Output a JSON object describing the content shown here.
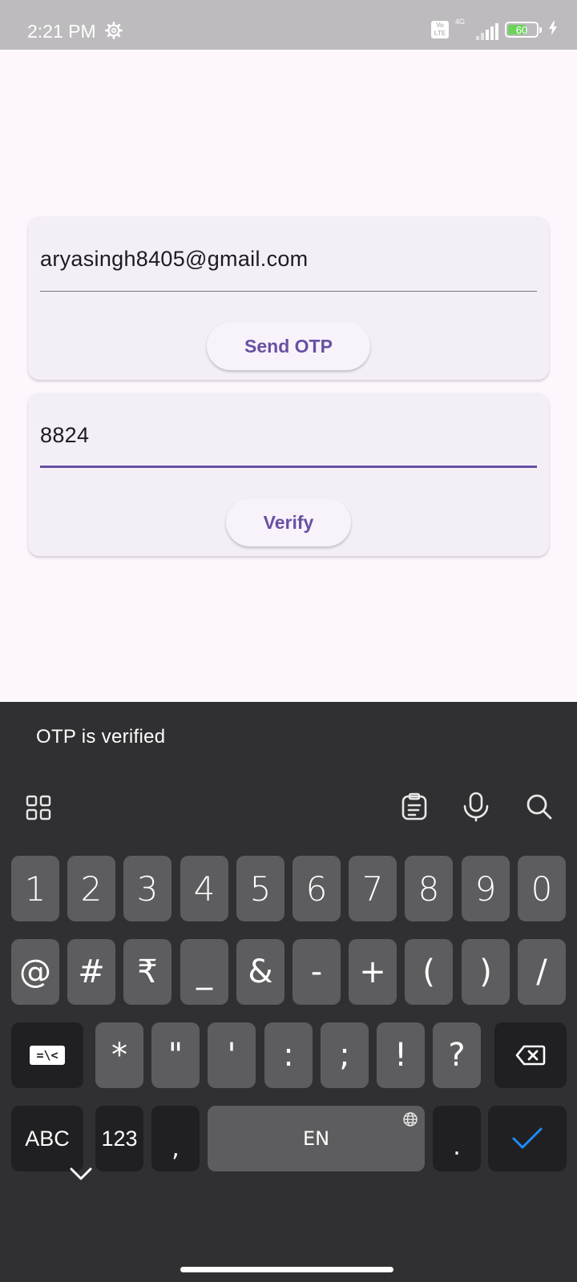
{
  "status_bar": {
    "time": "2:21 PM",
    "network": "4G",
    "volte": "Vo LTE",
    "battery": "60",
    "icons": [
      "gear-icon",
      "volte-icon",
      "signal-icon",
      "battery-icon",
      "charging-icon"
    ]
  },
  "email_card": {
    "email_value": "aryasingh8405@gmail.com",
    "send_button_label": "Send OTP"
  },
  "otp_card": {
    "otp_value": "8824",
    "verify_button_label": "Verify"
  },
  "snackbar": {
    "message": "OTP is verified"
  },
  "keyboard": {
    "toolbar_icons": [
      "apps-grid-icon",
      "clipboard-icon",
      "microphone-icon",
      "search-icon"
    ],
    "row1": [
      "1",
      "2",
      "3",
      "4",
      "5",
      "6",
      "7",
      "8",
      "9",
      "0"
    ],
    "row2": [
      "@",
      "#",
      "₹",
      "_",
      "&",
      "-",
      "+",
      "(",
      ")",
      "/"
    ],
    "row3": [
      "*",
      "\"",
      "'",
      ":",
      ";",
      "!",
      "?"
    ],
    "more_symbols_label": "=\\<",
    "abc_label": "ABC",
    "num_label": "123",
    "comma": ",",
    "space_label": "EN",
    "period": ".",
    "colors": {
      "key": "#5d5d5f",
      "dark_key": "#202022",
      "background": "#303032",
      "accent": "#1a8cff"
    }
  },
  "colors": {
    "primary": "#6750a4",
    "card": "#f4eff6",
    "background": "#fdf7fd",
    "status_bar": "#bdbbbd"
  }
}
